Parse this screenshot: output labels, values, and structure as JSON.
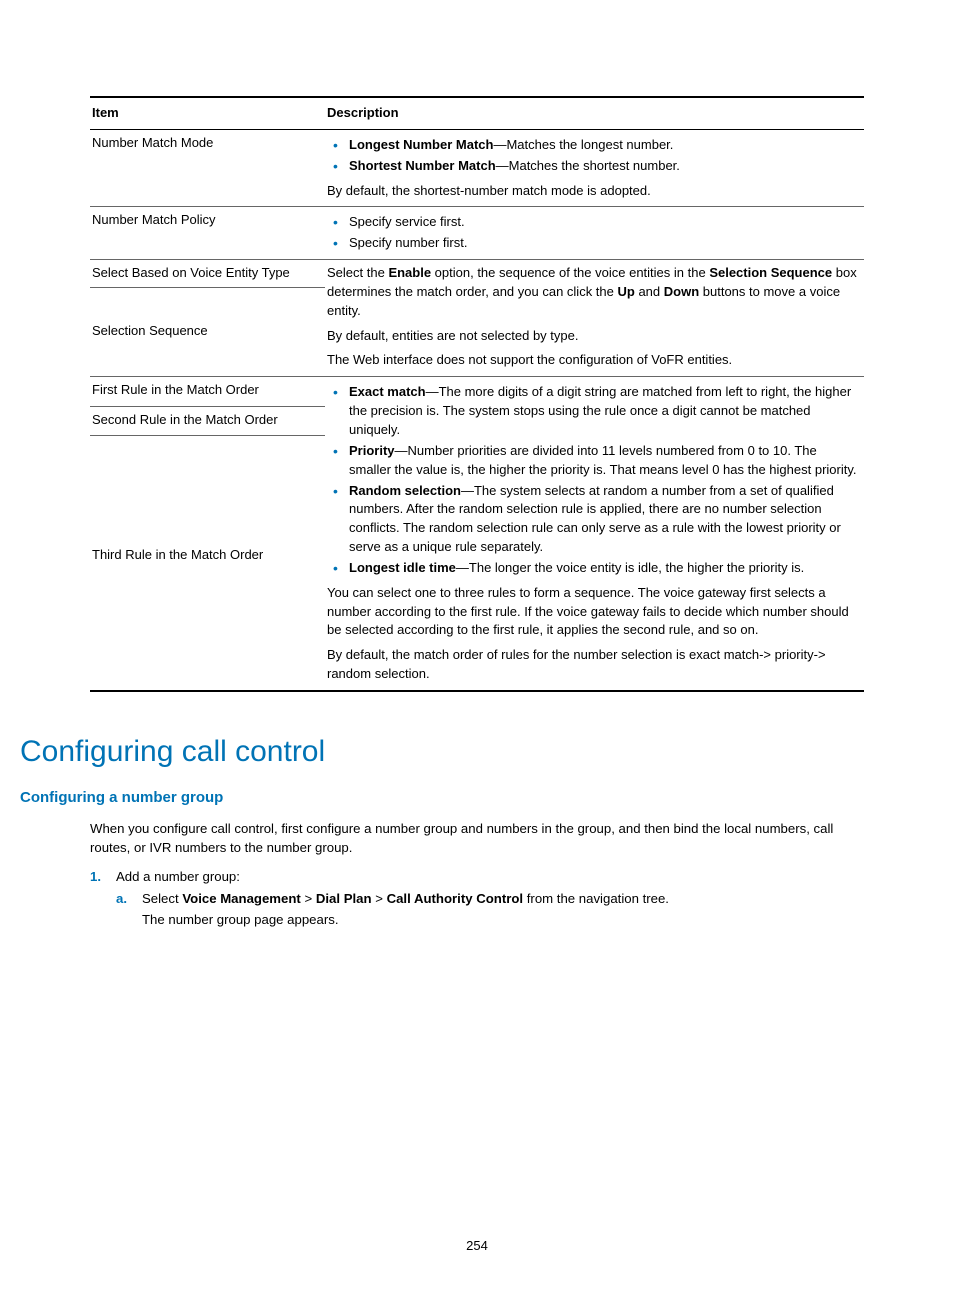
{
  "table": {
    "headers": {
      "item": "Item",
      "desc": "Description"
    },
    "row1": {
      "item": "Number Match Mode",
      "b1_bold": "Longest Number Match",
      "b1_rest": "—Matches the longest number.",
      "b2_bold": "Shortest Number Match",
      "b2_rest": "—Matches the shortest number.",
      "after": "By default, the shortest-number match mode is adopted."
    },
    "row2": {
      "item": "Number Match Policy",
      "b1": "Specify service first.",
      "b2": "Specify number first."
    },
    "row3": {
      "item": "Select Based on Voice Entity Type"
    },
    "row4": {
      "item": "Selection Sequence",
      "p1a": "Select the ",
      "p1b_bold": "Enable",
      "p1c": " option, the sequence of the voice entities in the ",
      "p1d_bold": "Selection Sequence",
      "p1e": " box determines the match order, and you can click the ",
      "p1f_bold": "Up",
      "p1g": " and ",
      "p1h_bold": "Down",
      "p1i": " buttons to move a voice entity.",
      "p2": "By default, entities are not selected by type.",
      "p3": "The Web interface does not support the configuration of VoFR entities."
    },
    "row5": {
      "item": "First Rule in the Match Order"
    },
    "row6": {
      "item": "Second Rule in the Match Order"
    },
    "row7": {
      "item": "Third Rule in the Match Order",
      "b1_bold": "Exact match",
      "b1_rest": "—The more digits of a digit string are matched from left to right, the higher the precision is. The system stops using the rule once a digit cannot be matched uniquely.",
      "b2_bold": "Priority",
      "b2_rest": "—Number priorities are divided into 11 levels numbered from 0 to 10. The smaller the value is, the higher the priority is. That means level 0 has the highest priority.",
      "b3_bold": "Random selection",
      "b3_rest": "—The system selects at random a number from a set of qualified numbers. After the random selection rule is applied, there are no number selection conflicts. The random selection rule can only serve as a rule with the lowest priority or serve as a unique rule separately.",
      "b4_bold": "Longest idle time",
      "b4_rest": "—The longer the voice entity is idle, the higher the priority is.",
      "p1": "You can select one to three rules to form a sequence. The voice gateway first selects a number according to the first rule. If the voice gateway fails to decide which number should be selected according to the first rule, it applies the second rule, and so on.",
      "p2": "By default, the match order of rules for the number selection is exact match-> priority-> random selection."
    }
  },
  "section": {
    "h1": "Configuring call control",
    "h2": "Configuring a number group",
    "intro": "When you configure call control, first configure a number group and numbers in the group, and then bind the local numbers, call routes, or IVR numbers to the number group.",
    "step1_num": "1.",
    "step1_text": "Add a number group:",
    "step1a_let": "a.",
    "step1a_a": "Select ",
    "step1a_b_bold": "Voice Management",
    "step1a_c": " > ",
    "step1a_d_bold": "Dial Plan",
    "step1a_e": " > ",
    "step1a_f_bold": "Call Authority Control",
    "step1a_g": " from the navigation tree.",
    "step1a_after": "The number group page appears."
  },
  "pagenum": "254"
}
